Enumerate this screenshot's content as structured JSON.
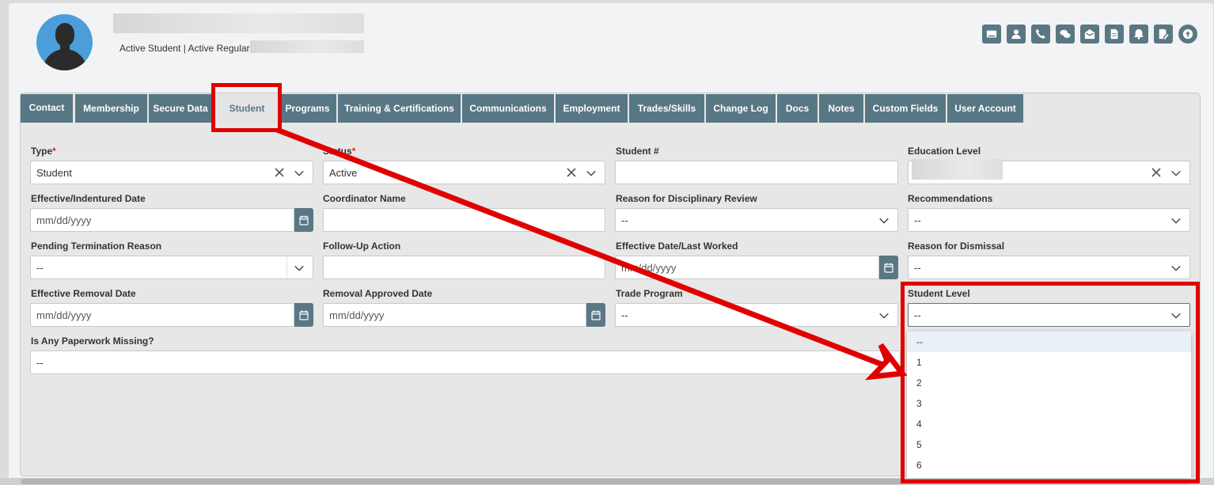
{
  "header": {
    "status_text": "Active Student | Active Regular",
    "icons": [
      "id-card-icon",
      "person-icon",
      "phone-icon",
      "chat-icon",
      "envelope-icon",
      "document-icon",
      "bell-icon",
      "note-edit-icon",
      "upload-icon"
    ]
  },
  "tabs": [
    {
      "label": "Contact"
    },
    {
      "label": "Membership"
    },
    {
      "label": "Secure Data"
    },
    {
      "label": "Student"
    },
    {
      "label": "Programs"
    },
    {
      "label": "Training & Certifications"
    },
    {
      "label": "Communications"
    },
    {
      "label": "Employment"
    },
    {
      "label": "Trades/Skills"
    },
    {
      "label": "Change Log"
    },
    {
      "label": "Docs"
    },
    {
      "label": "Notes"
    },
    {
      "label": "Custom Fields"
    },
    {
      "label": "User Account"
    }
  ],
  "active_tab": "Student",
  "form": {
    "type": {
      "label": "Type",
      "required_mark": "*",
      "value": "Student"
    },
    "status": {
      "label": "Status",
      "required_mark": "*",
      "value": "Active"
    },
    "student_number": {
      "label": "Student #",
      "value": ""
    },
    "education_level": {
      "label": "Education Level",
      "value": ""
    },
    "effective_date": {
      "label": "Effective/Indentured Date",
      "placeholder": "mm/dd/yyyy"
    },
    "coordinator_name": {
      "label": "Coordinator Name",
      "value": ""
    },
    "disciplinary_reason": {
      "label": "Reason for Disciplinary Review",
      "value": "--"
    },
    "recommendations": {
      "label": "Recommendations",
      "value": "--"
    },
    "pending_termination": {
      "label": "Pending Termination Reason",
      "value": "--"
    },
    "follow_up": {
      "label": "Follow-Up Action",
      "value": ""
    },
    "last_worked": {
      "label": "Effective Date/Last Worked",
      "placeholder": "mm/dd/yyyy"
    },
    "dismissal_reason": {
      "label": "Reason for Dismissal",
      "value": "--"
    },
    "removal_date": {
      "label": "Effective Removal Date",
      "placeholder": "mm/dd/yyyy"
    },
    "removal_approved": {
      "label": "Removal Approved Date",
      "placeholder": "mm/dd/yyyy"
    },
    "trade_program": {
      "label": "Trade Program",
      "value": "--"
    },
    "student_level": {
      "label": "Student Level",
      "value": "--",
      "options": [
        "--",
        "1",
        "2",
        "3",
        "4",
        "5",
        "6"
      ]
    },
    "paperwork_missing": {
      "label": "Is Any Paperwork Missing?",
      "value": "--"
    }
  },
  "colors": {
    "tab_bg": "#587784",
    "annotation_red": "#e00000",
    "accent": "#5a7784"
  }
}
